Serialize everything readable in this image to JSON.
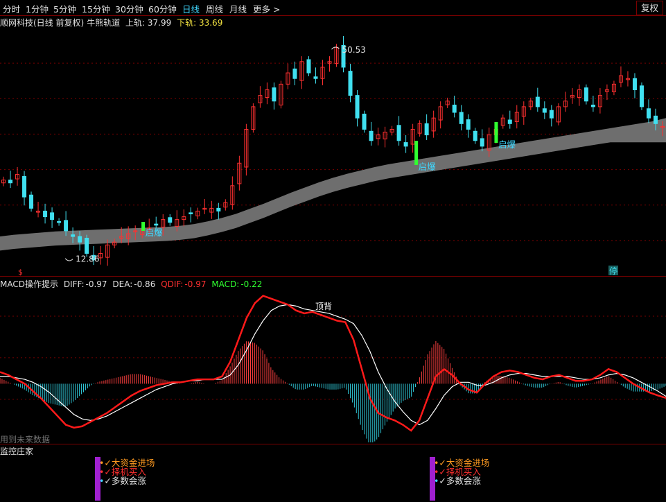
{
  "toolbar": {
    "periods": [
      "分时",
      "1分钟",
      "5分钟",
      "15分钟",
      "30分钟",
      "60分钟",
      "日线",
      "周线",
      "月线",
      "更多 >"
    ],
    "active": "日线",
    "restore_button": "复权"
  },
  "main_legend": {
    "title": "顺网科技(日线 前复权)",
    "indicator": "牛熊轨道",
    "upper_label": "上轨:",
    "upper_value": "37.99",
    "lower_label": "下轨:",
    "lower_value": "33.69"
  },
  "price_annotations": {
    "high": "50.53",
    "low": "12.86",
    "signal": "启爆",
    "stop_badge": "停"
  },
  "macd_legend": {
    "title": "MACD操作提示",
    "diff_label": "DIFF:",
    "diff_value": "-0.97",
    "dea_label": "DEA:",
    "dea_value": "-0.86",
    "qdif_label": "QDIF:",
    "qdif_value": "-0.97",
    "macd_label": "MACD:",
    "macd_value": "-0.22",
    "annotation": "顶背",
    "footnote": "用到未来数据"
  },
  "monitor": {
    "title": "监控庄家",
    "lines": [
      "大资金进场",
      "择机买入",
      "多数会涨"
    ]
  },
  "colors": {
    "up": "#ff3030",
    "down": "#40e0f0",
    "band": "#6e6e6e",
    "signal_bar": "#30ff30",
    "diff": "#ff1a1a",
    "dea": "#ffffff",
    "grid": "#7a0000",
    "macd_pos": "#ff4040",
    "macd_neg": "#30c8d8",
    "purple": "#a020d0"
  },
  "chart_data": [
    {
      "type": "candlestick",
      "title": "顺网科技(日线 前复权)",
      "ylim": [
        10,
        54
      ],
      "close": [
        27,
        26.5,
        28,
        24,
        22,
        21.5,
        20.5,
        20,
        19.5,
        18,
        17,
        16,
        14,
        12.86,
        14,
        15.5,
        16,
        17,
        17.5,
        18,
        18.2,
        18.5,
        19,
        20,
        19.5,
        20,
        20.5,
        21,
        21.5,
        22,
        22,
        21.5,
        23,
        26,
        30,
        36,
        40,
        42,
        43,
        41,
        44,
        46,
        45,
        48,
        46,
        45,
        47,
        48,
        50.53,
        47,
        42,
        38,
        36,
        34,
        35,
        35.5,
        36,
        34,
        33,
        36,
        37,
        35,
        38,
        40,
        41,
        39,
        37,
        36,
        34,
        33,
        35,
        36,
        38,
        37,
        39,
        40,
        41,
        40,
        39,
        38,
        40,
        41,
        42,
        43,
        41,
        40,
        42,
        43,
        44,
        45.5,
        45,
        43,
        40,
        38,
        37,
        36.5
      ],
      "band_upper": [
        17,
        17.3,
        17.5,
        17.7,
        17.9,
        18,
        18.1,
        18.2,
        18.3,
        18.4,
        18.5,
        18.6,
        18.7,
        18.9,
        19.2,
        19.7,
        20.3,
        21,
        21.9,
        22.8,
        23.8,
        24.8,
        25.7,
        26.6,
        27.4,
        28.1,
        28.7,
        29.3,
        29.8,
        30.2,
        30.6,
        31,
        31.4,
        31.8,
        32.2,
        32.6,
        33,
        33.4,
        33.8,
        34.2,
        34.6,
        35,
        35.4,
        35.8,
        36.2,
        36.6,
        37,
        37.4,
        37.99
      ],
      "band_lower": [
        14.5,
        14.8,
        15,
        15.2,
        15.4,
        15.5,
        15.6,
        15.7,
        15.8,
        15.9,
        16,
        16.1,
        16.2,
        16.4,
        16.7,
        17.2,
        17.8,
        18.5,
        19.4,
        20.3,
        21.3,
        22.3,
        23.2,
        24.1,
        24.9,
        25.6,
        26.2,
        26.8,
        27.3,
        27.7,
        28.1,
        28.5,
        28.9,
        29.3,
        29.7,
        30.1,
        30.5,
        30.9,
        31.3,
        31.7,
        32.1,
        32.5,
        32.9,
        33.3,
        33.69,
        33.69,
        33.69,
        33.69,
        33.69
      ],
      "high_label": 50.53,
      "low_label": 12.86,
      "last_upper": 37.99,
      "last_lower": 33.69
    },
    {
      "type": "line",
      "title": "MACD操作提示",
      "series": [
        {
          "name": "DIFF",
          "values": [
            0.8,
            0.6,
            0.3,
            0,
            -0.5,
            -1.0,
            -1.6,
            -2.2,
            -2.8,
            -3.0,
            -2.9,
            -2.6,
            -2.3,
            -2.0,
            -1.6,
            -1.2,
            -0.8,
            -0.5,
            -0.3,
            -0.1,
            0,
            0.1,
            0.1,
            0.2,
            0.3,
            0.3,
            0.3,
            0.5,
            1.5,
            3.0,
            4.5,
            5.5,
            6.0,
            5.8,
            5.6,
            5.4,
            5.0,
            4.8,
            4.9,
            4.7,
            4.5,
            4.3,
            4.2,
            3.0,
            1.0,
            -1.0,
            -2.0,
            -2.3,
            -2.5,
            -2.8,
            -3.2,
            -2.5,
            -1.0,
            0.5,
            1.0,
            0.6,
            0,
            -0.4,
            -0.6,
            0,
            0.5,
            0.8,
            0.9,
            0.8,
            0.6,
            0.4,
            0.3,
            0.5,
            0.6,
            0.4,
            0.2,
            0.2,
            0.3,
            0.6,
            1.0,
            0.8,
            0.4,
            0,
            -0.3,
            -0.6,
            -0.8,
            -0.97
          ]
        },
        {
          "name": "DEA",
          "values": [
            0.5,
            0.5,
            0.4,
            0.3,
            0.1,
            -0.2,
            -0.6,
            -1.1,
            -1.6,
            -2.1,
            -2.4,
            -2.5,
            -2.4,
            -2.2,
            -1.9,
            -1.6,
            -1.3,
            -1.0,
            -0.7,
            -0.4,
            -0.2,
            0,
            0.1,
            0.2,
            0.2,
            0.3,
            0.3,
            0.3,
            0.6,
            1.3,
            2.3,
            3.4,
            4.3,
            5.0,
            5.3,
            5.4,
            5.3,
            5.1,
            5.0,
            4.9,
            4.8,
            4.6,
            4.4,
            4.1,
            3.3,
            2.2,
            0.8,
            -0.3,
            -1.2,
            -1.9,
            -2.5,
            -2.8,
            -2.5,
            -1.7,
            -0.8,
            -0.2,
            0.1,
            0.1,
            -0.1,
            -0.1,
            0.1,
            0.4,
            0.6,
            0.7,
            0.7,
            0.6,
            0.5,
            0.5,
            0.5,
            0.5,
            0.4,
            0.3,
            0.3,
            0.4,
            0.6,
            0.7,
            0.6,
            0.4,
            0.1,
            -0.2,
            -0.5,
            -0.86
          ]
        }
      ],
      "diff": -0.97,
      "dea": -0.86,
      "qdif": -0.97,
      "macd": -0.22
    }
  ]
}
